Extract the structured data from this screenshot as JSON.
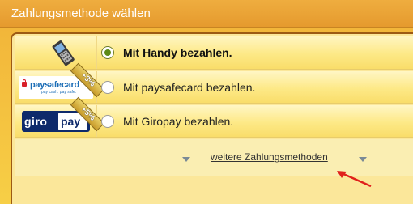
{
  "header": {
    "title": "Zahlungsmethode wählen"
  },
  "options": [
    {
      "icon": "mobile-phone-icon",
      "label": "Mit Handy bezahlen.",
      "selected": true,
      "badge": ""
    },
    {
      "icon": "paysafecard-logo",
      "label": "Mit paysafecard bezahlen.",
      "selected": false,
      "badge": "+3%",
      "logo_text": "paysafecard",
      "logo_sub": "pay cash. pay safe."
    },
    {
      "icon": "giropay-logo",
      "label": "Mit Giropay bezahlen.",
      "selected": false,
      "badge": "+5%",
      "logo_left": "giro",
      "logo_right": "pay"
    }
  ],
  "more": {
    "label": "weitere Zahlungsmethoden"
  },
  "colors": {
    "header": "#e9a338",
    "selected_radio": "#5d8a16",
    "giropay_blue": "#0e2a6b",
    "paysafe_blue": "#1b6db6",
    "annotation_arrow": "#e0201c"
  }
}
